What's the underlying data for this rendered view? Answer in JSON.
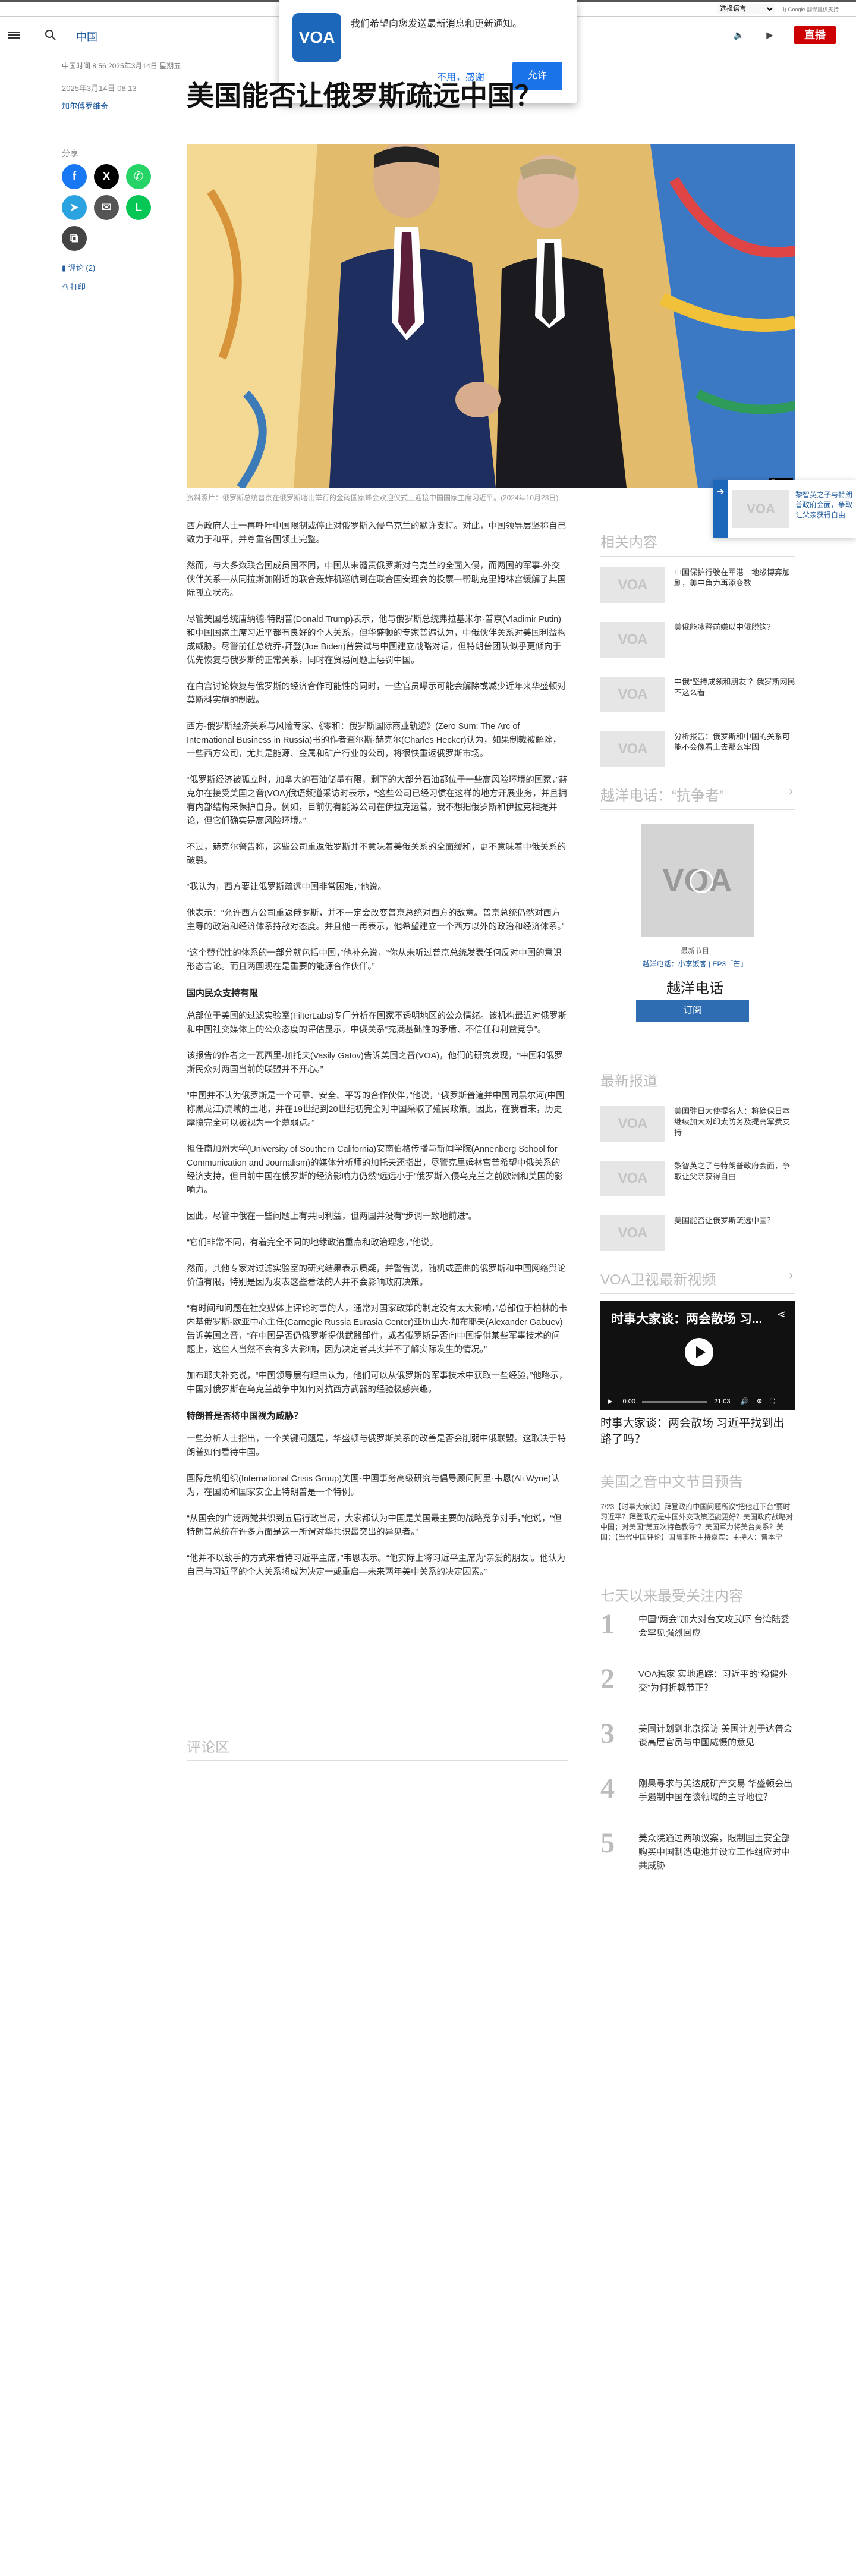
{
  "language_select": "选择语言",
  "google_note": "由 Google 翻译提供支持",
  "header": {
    "link": "中国",
    "live": "直播"
  },
  "notification": {
    "logo": "VOA",
    "message": "我们希望向您发送最新消息和更新通知。",
    "decline": "不用，感谢",
    "accept": "允许"
  },
  "article": {
    "dateline": "中国时间 8:56 2025年3月14日 星期五",
    "date": "2025年3月14日 08:13",
    "author": "加尔傅罗维奇",
    "title": "美国能否让俄罗斯疏远中国？",
    "share_label": "分享",
    "comments_label": "评论 (2)",
    "print_label": "打印",
    "caption": "资料照片：俄罗斯总统普京在俄罗斯喀山举行的金砖国家峰会欢迎仪式上迎接中国国家主席习近平。(2024年10月23日)",
    "photo_credit": "Reuters",
    "paragraphs": [
      "西方政府人士一再呼吁中国限制或停止对俄罗斯入侵乌克兰的默许支持。对此，中国领导层坚称自己致力于和平，并尊重各国领土完整。",
      "然而，与大多数联合国成员国不同，中国从未谴责俄罗斯对乌克兰的全面入侵，而两国的军事-外交伙伴关系—从同拉斯加附近的联合轰炸机巡航到在联合国安理会的投票—帮助克里姆林宫缓解了其国际孤立状态。",
      "尽管美国总统唐纳德·特朗普(Donald Trump)表示，他与俄罗斯总统弗拉基米尔·普京(Vladimir Putin)和中国国家主席习近平都有良好的个人关系，但华盛顿的专家普遍认为，中俄伙伴关系对美国利益构成威胁。尽管前任总统乔·拜登(Joe Biden)曾尝试与中国建立战略对话，但特朗普团队似乎更倾向于优先恢复与俄罗斯的正常关系，同时在贸易问题上惩罚中国。",
      "在白宫讨论恢复与俄罗斯的经济合作可能性的同时，一些官员曝示可能会解除或减少近年来华盛顿对莫斯科实施的制裁。",
      "西方-俄罗斯经济关系与风险专家、《零和：俄罗斯国际商业轨迹》(Zero Sum: The Arc of International Business in Russia)书的作者查尔斯·赫克尔(Charles Hecker)认为，如果制裁被解除，一些西方公司，尤其是能源、金属和矿产行业的公司，将很快重返俄罗斯市场。",
      "“俄罗斯经济被孤立时，加拿大的石油储量有限，剩下的大部分石油都位于一些高风险环境的国家，”赫克尔在接受美国之音(VOA)俄语频道采访时表示，“这些公司已经习惯在这样的地方开展业务，并且拥有内部结构来保护自身。例如，目前仍有能源公司在伊拉克运营。我不想把俄罗斯和伊拉克相提并论，但它们确实是高风险环境。”",
      "不过，赫克尔警告称，这些公司重返俄罗斯并不意味着美俄关系的全面缓和，更不意味着中俄关系的破裂。",
      "“我认为，西方要让俄罗斯疏远中国非常困难，”他说。",
      "他表示：“允许西方公司重返俄罗斯，并不一定会改变普京总统对西方的敌意。普京总统仍然对西方主导的政治和经济体系持敌对态度。并且他一再表示，他希望建立一个西方以外的政治和经济体系。”",
      "“这个替代性的体系的一部分就包括中国，”他补充说，“你从未听过普京总统发表任何反对中国的意识形态言论。而且两国现在是重要的能源合作伙伴。”"
    ],
    "subhead1": "国内民众支持有限",
    "paragraphs2": [
      "总部位于美国的过滤实验室(FilterLabs)专门分析在国家不透明地区的公众情绪。该机构最近对俄罗斯和中国社交媒体上的公众态度的评估显示，中俄关系“充满基础性的矛盾、不信任和利益竞争”。",
      "该报告的作者之一瓦西里·加托夫(Vasily Gatov)告诉美国之音(VOA)，他们的研究发现，“中国和俄罗斯民众对两国当前的联盟并不开心。”",
      "“中国并不认为俄罗斯是一个可靠、安全、平等的合作伙伴，”他说，“俄罗斯普遍并中国同黑尔河(中国称黑龙江)流域的土地，并在19世纪到20世纪初完全对中国采取了殖民政策。因此，在我看来，历史摩擦完全可以被视为一个薄弱点。”",
      "担任南加州大学(University of Southern California)安南伯格传播与新闻学院(Annenberg School for Communication and Journalism)的媒体分析师的加托夫还指出，尽管克里姆林宫普希望中俄关系的经济支持，但目前中国在俄罗斯的经济影响力仍然“远远小于”俄罗斯入侵乌克兰之前欧洲和美国的影响力。",
      "因此，尽管中俄在一些问题上有共同利益，但两国并没有“步调一致地前进”。",
      "“它们非常不同，有着完全不同的地缘政治重点和政治理念，”他说。",
      "然而，其他专家对过滤实验室的研究结果表示质疑，并警告说，随机或歪曲的俄罗斯和中国网络舆论价值有限，特别是因为发表这些看法的人并不会影响政府决策。",
      "“有时间和问题在社交媒体上评论时事的人，通常对国家政策的制定没有太大影响，”总部位于柏林的卡内基俄罗斯-欧亚中心主任(Carnegie Russia Eurasia Center)亚历山大·加布耶夫(Alexander Gabuev)告诉美国之音，“在中国是否仍俄罗斯提供武器部件，或者俄罗斯是否向中国提供某些军事技术的问题上，这些人当然不会有多大影响，因为决定者其实并不了解实际发生的情况。”",
      "加布耶夫补充说，“中国领导层有理由认为，他们可以从俄罗斯的军事技术中获取一些经验，”他略示，中国对俄罗斯在乌克兰战争中如何对抗西方武器的经验极感兴趣。"
    ],
    "subhead2": "特朗普是否将中国视为威胁？",
    "paragraphs3": [
      "一些分析人士指出，一个关键问题是，华盛顿与俄罗斯关系的改善是否会削弱中俄联盟。这取决于特朗普如何看待中国。",
      "国际危机组织(International Crisis Group)美国-中国事务高级研究与倡导顾问阿里·韦恩(Ali Wyne)认为，在国防和国家安全上特朗普是一个特例。",
      "“从国会的广泛两党共识到五届行政当局，大家都认为中国是美国最主要的战略竞争对手，”他说，“但特朗普总统在许多方面是这一所谓对华共识最突出的异见者。”",
      "“他并不以敌手的方式来看待习近平主席，”韦恩表示。“他实际上将习近平主席为‘亲爱的朋友’。他认为自己与习近平的个人关系将成为决定一或重启—未来两年美中关系的决定因素。”"
    ],
    "comments_section": "评论区"
  },
  "sidebar": {
    "related_title": "相关内容",
    "related": [
      "中国保护行驶在军港—地缘博弈加剧，美中角力再添变数",
      "美俄能冰释前嫌以中俄脱钩？",
      "中俄“坚持成领和朋友”？俄罗斯网民不这么看",
      "分析报告：俄罗斯和中国的关系可能不会像看上去那么牢固"
    ],
    "podcast_title": "越洋电话：“抗争者”",
    "podcast_latest": "最新节目",
    "podcast_meta": "越洋电话：小李饭客 | EP3「芒」",
    "podcast_name": "越洋电话",
    "subscribe": "订阅",
    "latest_title": "最新报道",
    "latest": [
      "美国驻日大使提名人：将确保日本继续加大对印太防务及提高军费支持",
      "黎智英之子与特朗普政府会面，争取让父亲获得自由",
      "美国能否让俄罗斯疏远中国？"
    ],
    "video_section": "VOA卫视最新视频",
    "video_title": "时事大家谈：两会散场 习...",
    "video_time_start": "0:00",
    "video_time_end": "21:03",
    "video_caption": "时事大家谈：两会散场 习近平找到出路了吗？",
    "schedule_title": "美国之音中文节目预告",
    "schedule_text": "7/23【时事大家谈】拜登政府中国问题所议“把他赶下台”要时习近平？拜登政府是中国外交政策还能更好？美国政府战略对中国；对美国“第五次特色教导”？美国军力将美台关系？美国：【当代中国评论】国际事所主持嘉宾：主持人：曾本宁",
    "top_title": "七天以来最受关注内容",
    "top": [
      "中国“两会”加大对台文攻武吓 台湾陆委会罕见强烈回应",
      "VOA独家 实地追踪：习近平的“稳健外交”为何折戟节正？",
      "美国计划到北京探访 美国计划于达普会谈高层官员与中国威慑的意见",
      "刚果寻求与美达成矿产交易 华盛顿会出手遏制中国在该领域的主导地位？",
      "美众院通过两项议案，限制国土安全部购买中国制造电池并设立工作组应对中共威胁"
    ],
    "float_card": "黎智英之子与特朗普政府会面，争取让父亲获得自由"
  },
  "colors": {
    "accent": "#1f5b9e",
    "live": "#cc0000",
    "voa_blue": "#1c67b9"
  }
}
